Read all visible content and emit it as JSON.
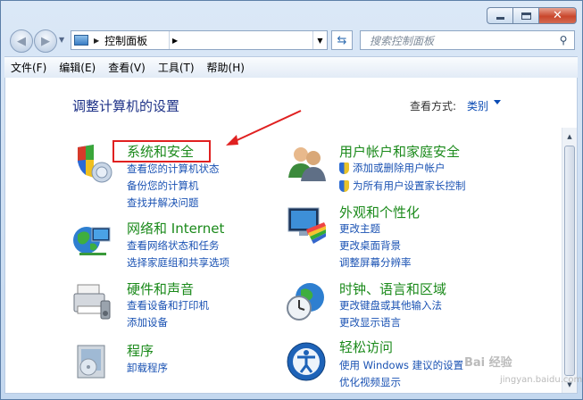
{
  "window": {
    "caption_close": "✕"
  },
  "nav": {
    "back_glyph": "◀",
    "forward_glyph": "▶",
    "address_path": "控制面板",
    "refresh_glyph": "⇆",
    "search_placeholder": "搜索控制面板",
    "search_glyph": "⚲"
  },
  "menu": [
    "文件(F)",
    "编辑(E)",
    "查看(V)",
    "工具(T)",
    "帮助(H)"
  ],
  "content": {
    "title": "调整计算机的设置",
    "view_by_label": "查看方式:",
    "view_by_value": "类别"
  },
  "categories": {
    "system_security": {
      "title": "系统和安全",
      "links": [
        "查看您的计算机状态",
        "备份您的计算机",
        "查找并解决问题"
      ]
    },
    "network": {
      "title": "网络和 Internet",
      "links": [
        "查看网络状态和任务",
        "选择家庭组和共享选项"
      ]
    },
    "hardware": {
      "title": "硬件和声音",
      "links": [
        "查看设备和打印机",
        "添加设备"
      ]
    },
    "programs": {
      "title": "程序",
      "links": [
        "卸载程序"
      ]
    },
    "users": {
      "title": "用户帐户和家庭安全",
      "links": [
        "添加或删除用户帐户",
        "为所有用户设置家长控制"
      ]
    },
    "appearance": {
      "title": "外观和个性化",
      "links": [
        "更改主题",
        "更改桌面背景",
        "调整屏幕分辨率"
      ]
    },
    "clock": {
      "title": "时钟、语言和区域",
      "links": [
        "更改键盘或其他输入法",
        "更改显示语言"
      ]
    },
    "ease": {
      "title": "轻松访问",
      "links": [
        "使用 Windows 建议的设置",
        "优化视频显示"
      ]
    }
  },
  "watermark": {
    "brand": "Bai 经验",
    "url": "jingyan.baidu.com"
  }
}
